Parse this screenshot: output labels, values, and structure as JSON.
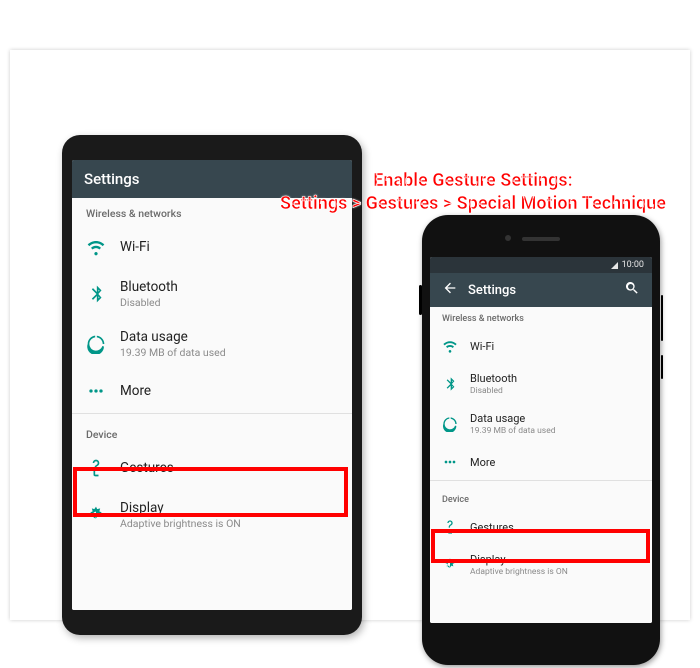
{
  "annotation": {
    "line1": "Enable Gesture Settings:",
    "line2": "Settings > Gestures > Special Motion Technique"
  },
  "tablet": {
    "appbar": {
      "title": "Settings"
    },
    "sections": {
      "wireless_header": "Wireless & networks",
      "device_header": "Device"
    },
    "rows": {
      "wifi": "Wi-Fi",
      "bluetooth": "Bluetooth",
      "bluetooth_sub": "Disabled",
      "data_usage": "Data usage",
      "data_usage_sub": "19.39 MB of data used",
      "more": "More",
      "gestures": "Gestures",
      "display": "Display",
      "display_sub": "Adaptive brightness is ON"
    }
  },
  "phone": {
    "statusbar_time": "10:00",
    "appbar": {
      "title": "Settings"
    },
    "sections": {
      "wireless_header": "Wireless & networks",
      "device_header": "Device"
    },
    "rows": {
      "wifi": "Wi-Fi",
      "bluetooth": "Bluetooth",
      "bluetooth_sub": "Disabled",
      "data_usage": "Data usage",
      "data_usage_sub": "19.39 MB of data used",
      "more": "More",
      "gestures": "Gestures",
      "display": "Display",
      "display_sub": "Adaptive brightness is ON"
    }
  }
}
